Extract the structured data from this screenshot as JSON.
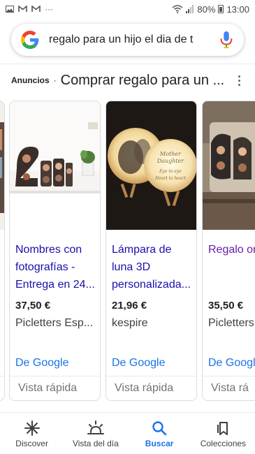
{
  "status_bar": {
    "battery": "80%",
    "time": "13:00",
    "left_icons": [
      "image-icon",
      "gmail-icon",
      "gmail-icon",
      "more-notifications-icon"
    ]
  },
  "search": {
    "query": "regalo para un hijo el dia de t"
  },
  "ads": {
    "label": "Anuncios",
    "dot": "·",
    "title": "Comprar regalo para un ..."
  },
  "cards": [
    {
      "title": "Nombres con fotografías - Entrega en 24...",
      "price": "37,50 €",
      "seller": "Picletters Esp...",
      "source": "De Google",
      "quick": "Vista rápida"
    },
    {
      "title": "Lámpara de luna 3D personalizada...",
      "price": "21,96 €",
      "seller": "kespire",
      "source": "De Google",
      "quick": "Vista rápida",
      "image_text": [
        "Mother",
        "Daughter",
        "Eye to eye",
        "Heart to heart"
      ]
    },
    {
      "title": "Regalo ori",
      "price": "35,50 €",
      "seller": "Picletters",
      "source": "De Googl",
      "quick": "Vista rá"
    }
  ],
  "bottom_nav": {
    "items": [
      {
        "label": "Discover",
        "icon": "asterisk-icon"
      },
      {
        "label": "Vista del día",
        "icon": "sunrise-icon"
      },
      {
        "label": "Buscar",
        "icon": "search-icon"
      },
      {
        "label": "Colecciones",
        "icon": "bookmarks-icon"
      }
    ],
    "active": "Buscar"
  },
  "colors": {
    "link": "#1a0dab",
    "visited": "#681da8",
    "google_blue": "#1a73e8",
    "muted": "#70757a"
  }
}
